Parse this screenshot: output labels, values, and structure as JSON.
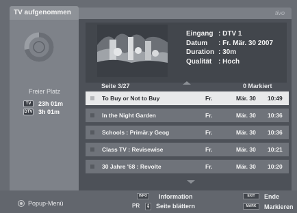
{
  "window": {
    "title": "TV aufgenommen",
    "brand": "tivo"
  },
  "sidebar": {
    "free_label": "Freier Platz",
    "storage": [
      {
        "icon": "TV",
        "value": "23h 01m"
      },
      {
        "icon": "DTV",
        "value": "3h 01m"
      }
    ],
    "used_fraction": 0.72
  },
  "details": {
    "labels": {
      "input": "Eingang",
      "date": "Datum",
      "duration": "Duration",
      "quality": "Qualität"
    },
    "values": {
      "input": ": DTV 1",
      "date": ": Fr. Mär. 30 2007",
      "duration": ": 30m",
      "quality": ": Hoch"
    }
  },
  "list_header": {
    "page": "Seite  3/27",
    "marked": "0 Markiert"
  },
  "recordings": [
    {
      "title": "To Buy or Not to Buy",
      "day": "Fr.",
      "date": "Mär. 30",
      "time": "10:49",
      "selected": true
    },
    {
      "title": "In the Night Garden",
      "day": "Fr.",
      "date": "Mär. 30",
      "time": "10:36",
      "selected": false
    },
    {
      "title": "Schools : Primär.y Geog",
      "day": "Fr.",
      "date": "Mär. 30",
      "time": "10:36",
      "selected": false
    },
    {
      "title": "Class TV : Revisewise",
      "day": "Fr.",
      "date": "Mär. 30",
      "time": "10:21",
      "selected": false
    },
    {
      "title": "30 Jahre '68 : Revolte",
      "day": "Fr.",
      "date": "Mär. 30",
      "time": "10:20",
      "selected": false
    }
  ],
  "footer": {
    "popup_menu": "Popup-Menü",
    "info_key": "INFO",
    "info_label": "Information",
    "pr_key": "PR",
    "page_label": "Seite blättern",
    "exit_key": "EXIT",
    "exit_label": "Ende",
    "mark_key": "MARK",
    "mark_label": "Markieren"
  },
  "colors": {
    "selected_row": "#e8e9ea",
    "row": "#6f737a",
    "panel": "#4d5158"
  }
}
